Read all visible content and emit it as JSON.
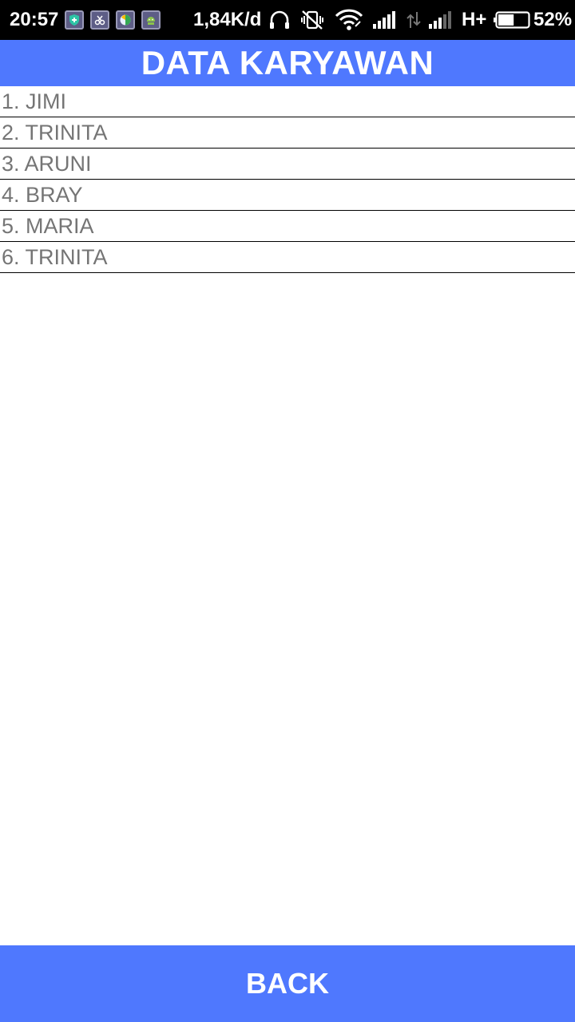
{
  "status_bar": {
    "time": "20:57",
    "net_speed": "1,84K/d",
    "network_type": "H+",
    "battery_percent": "52%",
    "battery_level": 0.52,
    "icons": [
      "shield-app-icon",
      "scissors-app-icon",
      "globe-app-icon",
      "android-app-icon",
      "headphones-icon",
      "vibrate-off-icon",
      "wifi-icon",
      "signal-icon",
      "data-arrows-icon",
      "signal-icon-2",
      "battery-icon"
    ]
  },
  "header": {
    "title": "DATA KARYAWAN",
    "color": "#4f78fe"
  },
  "employees": [
    "1. JIMI",
    "2. TRINITA",
    "3. ARUNI",
    "4. BRAY",
    "5. MARIA",
    "6. TRINITA"
  ],
  "footer": {
    "back_label": "BACK"
  }
}
